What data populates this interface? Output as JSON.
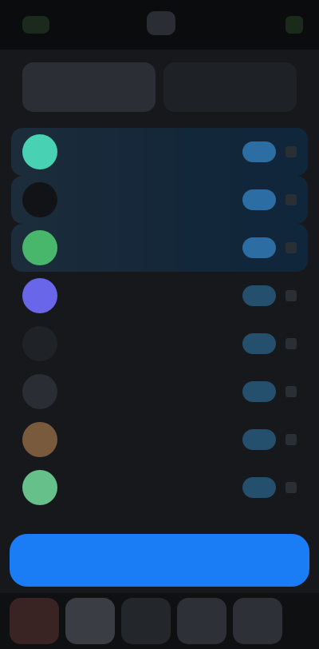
{
  "tabs": [
    {
      "label": "",
      "active": true
    },
    {
      "label": "",
      "active": false
    }
  ],
  "rows": [
    {
      "name": "",
      "meta": "",
      "pill": "",
      "icon_color": "#48d1b3",
      "tinted": true
    },
    {
      "name": "",
      "meta": "",
      "pill": "",
      "icon_color": "#111317",
      "tinted": true
    },
    {
      "name": "",
      "meta": "",
      "pill": "",
      "icon_color": "#49b76b",
      "tinted": true
    },
    {
      "name": "",
      "meta": "",
      "pill": "",
      "icon_color": "#6a66ea",
      "tinted": false
    },
    {
      "name": "",
      "meta": "",
      "pill": "",
      "icon_color": "#1f2226",
      "tinted": false
    },
    {
      "name": "",
      "meta": "",
      "pill": "",
      "icon_color": "#2a2d33",
      "tinted": false
    },
    {
      "name": "",
      "meta": "",
      "pill": "",
      "icon_color": "#7a5a3c",
      "tinted": false
    },
    {
      "name": "",
      "meta": "",
      "pill": "",
      "icon_color": "#66c08a",
      "tinted": false
    }
  ],
  "cta": {
    "label": ""
  },
  "colors": {
    "accent": "#1b7df5",
    "background": "#16181c"
  }
}
